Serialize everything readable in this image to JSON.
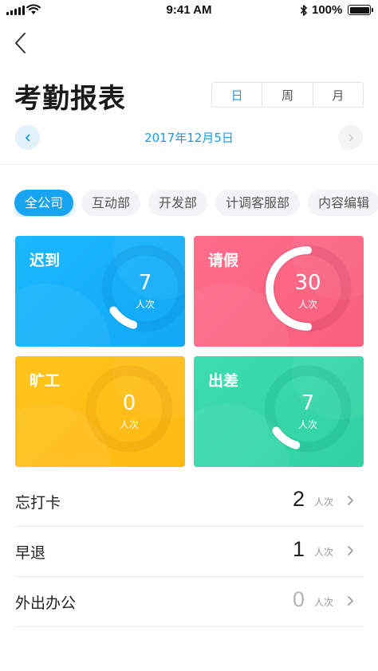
{
  "status_bar": {
    "time": "9:41 AM",
    "battery": "100%"
  },
  "header": {
    "title": "考勤报表"
  },
  "segments": [
    {
      "label": "日",
      "active": true
    },
    {
      "label": "周",
      "active": false
    },
    {
      "label": "月",
      "active": false
    }
  ],
  "date": {
    "label": "2017年12月5日"
  },
  "departments": [
    {
      "label": "全公司",
      "active": true
    },
    {
      "label": "互动部",
      "active": false
    },
    {
      "label": "开发部",
      "active": false
    },
    {
      "label": "计调客服部",
      "active": false
    },
    {
      "label": "内容编辑",
      "active": false
    }
  ],
  "cards": [
    {
      "title": "迟到",
      "count": "7",
      "unit": "人次",
      "color": "blue",
      "accent": "#12a8f5"
    },
    {
      "title": "请假",
      "count": "30",
      "unit": "人次",
      "color": "red",
      "accent": "#f85f7d"
    },
    {
      "title": "旷工",
      "count": "0",
      "unit": "人次",
      "color": "yellow",
      "accent": "#fdb912"
    },
    {
      "title": "出差",
      "count": "7",
      "unit": "人次",
      "color": "green",
      "accent": "#2fd1a2"
    }
  ],
  "rows": [
    {
      "label": "忘打卡",
      "count": "2",
      "unit": "人次",
      "muted": false
    },
    {
      "label": "早退",
      "count": "1",
      "unit": "人次",
      "muted": false
    },
    {
      "label": "外出办公",
      "count": "0",
      "unit": "人次",
      "muted": true
    }
  ],
  "colors": {
    "accent": "#1a9be8",
    "chip_active": "#19a4f2"
  }
}
